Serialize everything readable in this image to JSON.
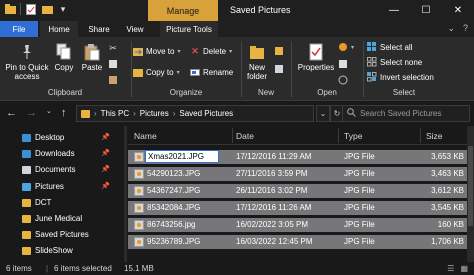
{
  "titlebar": {
    "manage": "Manage",
    "title": "Saved Pictures",
    "minimize": "—",
    "maximize": "☐",
    "close": "✕"
  },
  "tabs": {
    "file": "File",
    "home": "Home",
    "share": "Share",
    "view": "View",
    "picture_tools": "Picture Tools"
  },
  "ribbon": {
    "clipboard": {
      "pin_label": "Pin to Quick access",
      "copy": "Copy",
      "paste": "Paste",
      "group": "Clipboard"
    },
    "organize": {
      "move_to": "Move to",
      "copy_to": "Copy to",
      "delete": "Delete",
      "rename": "Rename",
      "group": "Organize"
    },
    "new": {
      "new_folder": "New folder",
      "group": "New"
    },
    "open": {
      "properties": "Properties",
      "group": "Open"
    },
    "select": {
      "select_all": "Select all",
      "select_none": "Select none",
      "invert": "Invert selection",
      "group": "Select"
    }
  },
  "address": {
    "crumbs": [
      "This PC",
      "Pictures",
      "Saved Pictures"
    ],
    "search_placeholder": "Search Saved Pictures"
  },
  "nav": {
    "items": [
      {
        "label": "Desktop",
        "pinned": true,
        "color": "#3a8fd8"
      },
      {
        "label": "Downloads",
        "pinned": true,
        "color": "#3a8fd8"
      },
      {
        "label": "Documents",
        "pinned": true,
        "color": "#cfd6de"
      },
      {
        "label": "Pictures",
        "pinned": true,
        "color": "#4aa6e0"
      },
      {
        "label": "DCT",
        "pinned": false,
        "color": "#e7b443"
      },
      {
        "label": "June Medical",
        "pinned": false,
        "color": "#e7b443"
      },
      {
        "label": "Saved Pictures",
        "pinned": false,
        "color": "#e7b443"
      },
      {
        "label": "SlideShow",
        "pinned": false,
        "color": "#e7b443"
      }
    ]
  },
  "filelist": {
    "columns": [
      "Name",
      "Date",
      "Type",
      "Size"
    ],
    "rename_value": "Xmas2021.JPG",
    "rows": [
      {
        "name": "Xmas2021.JPG",
        "date": "17/12/2016 11:29 AM",
        "type": "JPG File",
        "size": "3,653 KB"
      },
      {
        "name": "54290123.JPG",
        "date": "27/11/2016 3:59 PM",
        "type": "JPG File",
        "size": "3,463 KB"
      },
      {
        "name": "54367247.JPG",
        "date": "26/11/2016 3:02 PM",
        "type": "JPG File",
        "size": "3,612 KB"
      },
      {
        "name": "85342084.JPG",
        "date": "17/12/2016 11:26 AM",
        "type": "JPG File",
        "size": "3,545 KB"
      },
      {
        "name": "86743256.jpg",
        "date": "16/02/2022 3:05 PM",
        "type": "JPG File",
        "size": "160 KB"
      },
      {
        "name": "95236789.JPG",
        "date": "16/03/2022 12:45 PM",
        "type": "JPG File",
        "size": "1,706 KB"
      }
    ]
  },
  "status": {
    "items": "6 items",
    "selected": "6 items selected",
    "size": "15.1 MB"
  }
}
